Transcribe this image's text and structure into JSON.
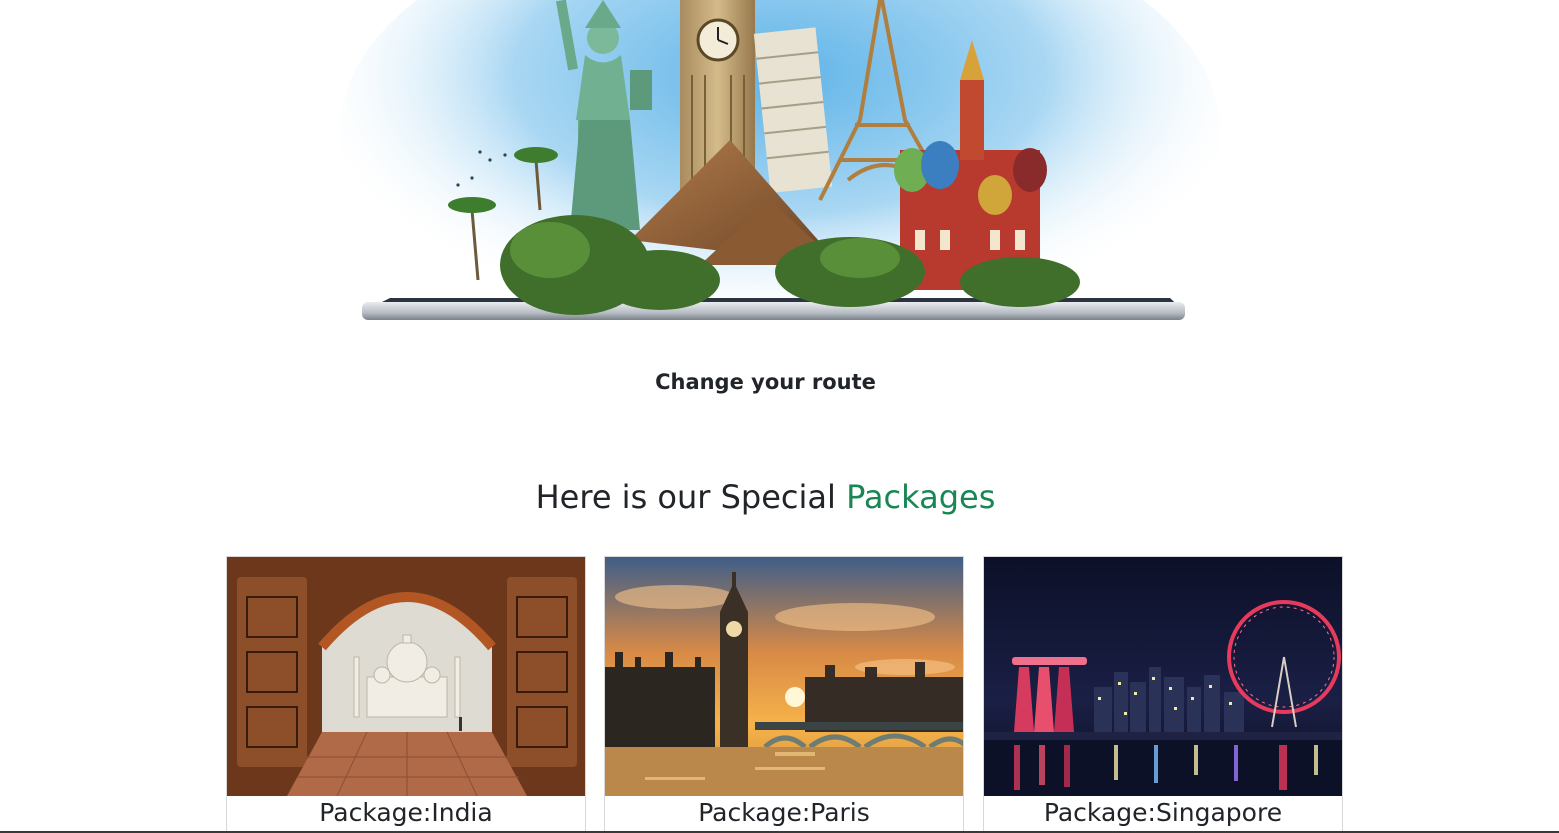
{
  "hero": {
    "tagline": "Change your route"
  },
  "packages_section": {
    "heading_prefix": "Here is our Special",
    "heading_accent": "Packages",
    "accent_color": "#198754",
    "cards": [
      {
        "title": "Package:India",
        "image": "taj-mahal-archway-photo"
      },
      {
        "title": "Package:Paris",
        "image": "big-ben-westminster-sunset-photo"
      },
      {
        "title": "Package:Singapore",
        "image": "singapore-marina-bay-night-photo"
      }
    ]
  }
}
